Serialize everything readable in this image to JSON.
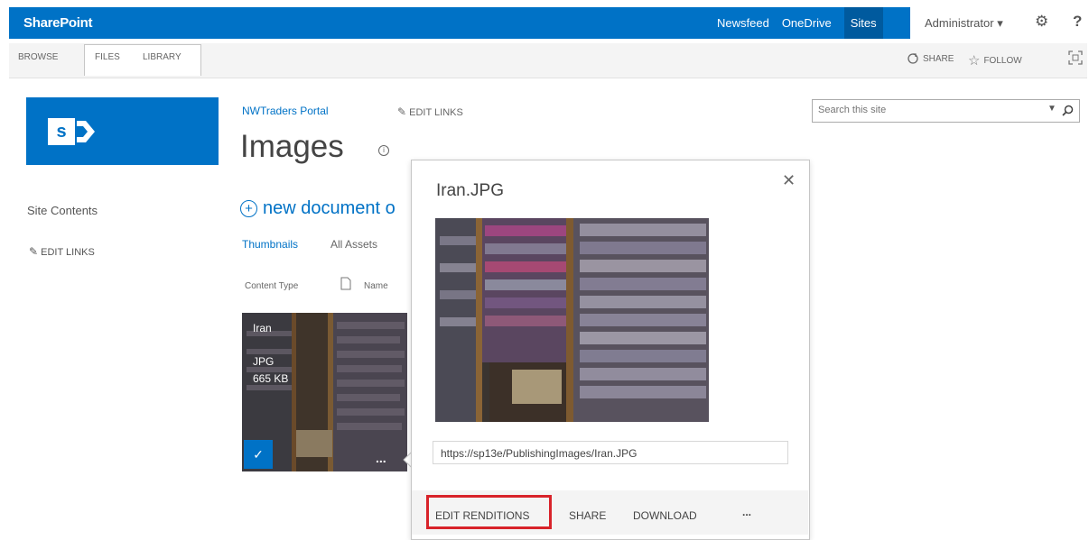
{
  "suite": {
    "brand": "SharePoint",
    "links": [
      "Newsfeed",
      "OneDrive",
      "Sites"
    ],
    "selected_link": "Sites",
    "user": "Administrator",
    "user_caret": "▾",
    "gear_icon": "gear-icon",
    "help": "?"
  },
  "ribbon": {
    "tabs": [
      "BROWSE",
      "FILES",
      "LIBRARY"
    ],
    "share": "SHARE",
    "follow": "FOLLOW",
    "focus_icon": "focus-icon"
  },
  "site": {
    "breadcrumb": "NWTraders Portal",
    "edit_links": "EDIT LINKS",
    "page_title": "Images",
    "search_placeholder": "Search this site"
  },
  "leftnav": {
    "site_contents": "Site Contents",
    "edit_links": "EDIT LINKS"
  },
  "library": {
    "new_document": "new document o",
    "views": [
      "Thumbnails",
      "All Assets"
    ],
    "columns": [
      "Content Type",
      "Name"
    ],
    "item": {
      "title": "Iran",
      "type": "JPG",
      "size": "665 KB",
      "more": "..."
    }
  },
  "callout": {
    "title": "Iran.JPG",
    "url": "https://sp13e/PublishingImages/Iran.JPG",
    "actions": [
      "EDIT RENDITIONS",
      "SHARE",
      "DOWNLOAD"
    ],
    "more": "...",
    "close": "✕"
  },
  "colors": {
    "suitebar": "#0072c6",
    "accent": "#0072c6",
    "highlight_box": "#d8232a"
  }
}
